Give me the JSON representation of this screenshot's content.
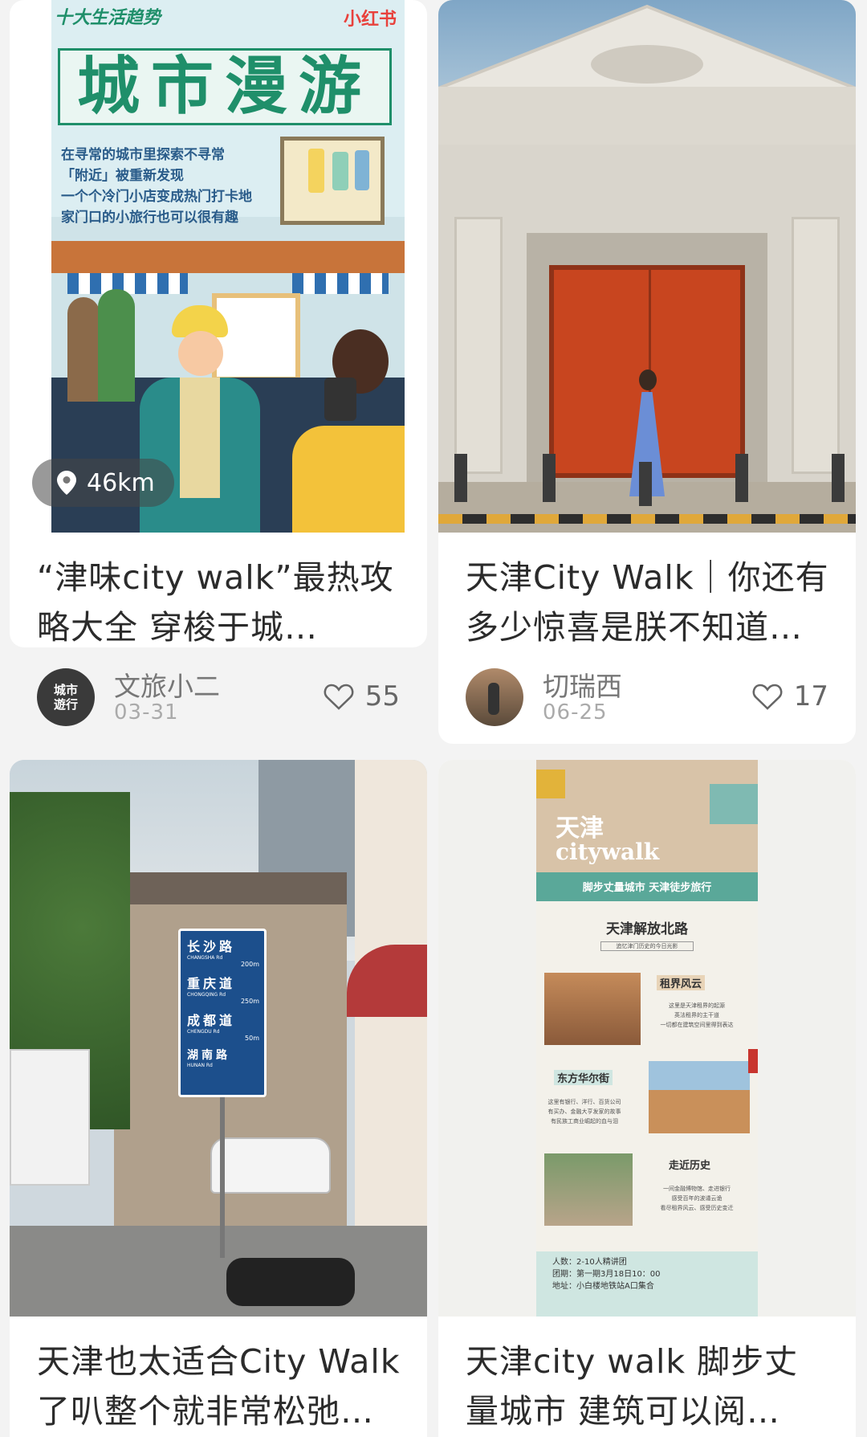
{
  "cards": [
    {
      "cover": {
        "badge": "十大生活趋势",
        "brand": "小红书",
        "headline": "城市漫游",
        "lines": [
          "在寻常的城市里探索不寻常",
          "「附近」被重新发现",
          "一个个冷门小店变成热门打卡地",
          "家门口的小旅行也可以很有趣"
        ],
        "distance": "46km"
      },
      "title": "“津味city walk”最热攻略大全 穿梭于城…",
      "author": "文旅小二",
      "date": "03-31",
      "likes": "55",
      "avatar_text": [
        "城市",
        "遊行"
      ]
    },
    {
      "title": "天津City Walk｜你还有多少惊喜是朕不知道…",
      "author": "切瑞西",
      "date": "06-25",
      "likes": "17"
    },
    {
      "cover": {
        "signs": [
          {
            "cn": "长沙路",
            "en": "CHANGSHA Rd",
            "dist": "200m"
          },
          {
            "cn": "重庆道",
            "en": "CHONGQING Rd",
            "dist": "250m"
          },
          {
            "cn": "成都道",
            "en": "CHENGDU Rd",
            "dist": "50m"
          },
          {
            "cn": "湖南路",
            "en": "HUNAN Rd",
            "dist": ""
          }
        ]
      },
      "title": "天津也太适合City Walk了叭整个就非常松弛…"
    },
    {
      "cover": {
        "title_cn": "天津",
        "title_en": "citywalk",
        "subtitle": "脚步丈量城市 天津徒步旅行",
        "route": "天津解放北路",
        "route_sub": "追忆津门历史的今日光影",
        "stops": [
          {
            "name": "租界风云",
            "desc": [
              "这里是天津租界的起源",
              "英法租界的主干道",
              "一切都在建筑空间里得到表达"
            ]
          },
          {
            "name": "东方华尔街",
            "desc": [
              "这里有银行、洋行、百货公司",
              "有买办、金融大亨发家的故事",
              "有民族工商业崛起的血与泪"
            ]
          },
          {
            "name": "走近历史",
            "desc": [
              "一间金融博物馆、走进银行",
              "感受百年的波谲云诡",
              "看尽租界风云、感受历史变迁"
            ]
          }
        ],
        "info": [
          "人数：2-10人精讲团",
          "团期：第一期3月18日10：00",
          "地址：小白楼地铁站A口集合"
        ]
      },
      "title": "天津city walk 脚步丈量城市 建筑可以阅…"
    }
  ],
  "colors": {
    "green": "#1f8f6a",
    "teal": "#5aa899",
    "door": "#c8451f",
    "signBlue": "#1c4f8c"
  }
}
